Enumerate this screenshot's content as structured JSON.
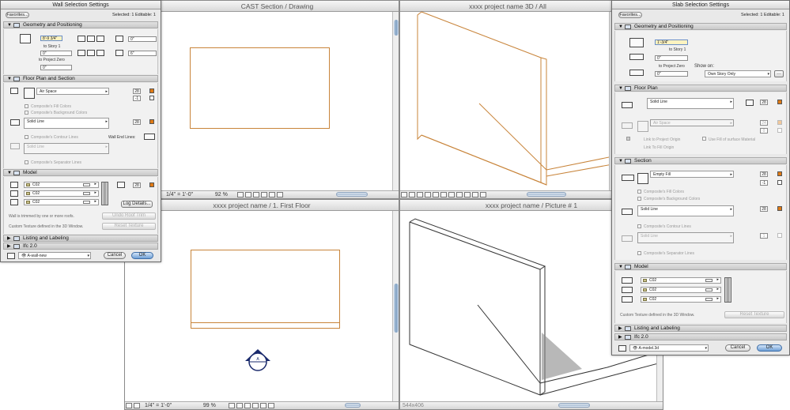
{
  "windows": {
    "section": {
      "title": "CAST Section / Drawing",
      "scale": "1/4\"  =  1'-0\"",
      "zoom": "92 %"
    },
    "view3d": {
      "title": "xxxx project name 3D / All"
    },
    "plan": {
      "title": "xxxx project name / 1. First Floor",
      "scale": "1/4\"  =  1'-0\"",
      "zoom": "99 %"
    },
    "picture": {
      "title": "xxxx project name / Picture # 1",
      "size": "544x406"
    }
  },
  "wall_dialog": {
    "title": "Wall Selection Settings",
    "favorites": "Favorites...",
    "selected": "Selected: 1 Editable: 1",
    "geometry": {
      "header": "Geometry and Positioning",
      "height": "8'-9 3/4\"",
      "to_story": "to Story 1",
      "base_offset": "0\"",
      "to_project_zero": "to Project Zero",
      "project_zero": "0\"",
      "thickness": "0\"",
      "thickness2": "6\""
    },
    "floor_plan": {
      "header": "Floor Plan and Section",
      "fill": "Air Space",
      "pen1": "28",
      "pen2": "-1",
      "composite_fill": "Composite's Fill Colors",
      "composite_bg": "Composite's Background Colors",
      "contour_line": "Solid Line",
      "pen3": "28",
      "composite_contour": "Composite's Contour Lines",
      "wall_end_lines": "Wall End Lines:",
      "sep_line": "Solid Line",
      "composite_sep": "Composite's Separator Lines"
    },
    "model": {
      "header": "Model",
      "materials": [
        "C02",
        "C02",
        "C02"
      ],
      "pen": "28",
      "log_details": "Log Details..."
    },
    "trim_note": "Wall is trimmed by one or more roofs.",
    "undo_roof_trim": "Undo Roof Trim",
    "texture_note": "Custom Texture defined in the 3D Window.",
    "reset_texture": "Reset Texture",
    "listing": "Listing and Labeling",
    "ifc": "Ifc 2.0",
    "layer": "A-wall-new",
    "cancel": "Cancel",
    "ok": "OK"
  },
  "slab_dialog": {
    "title": "Slab Selection Settings",
    "favorites": "Favorites...",
    "selected": "Selected: 1 Editable: 1",
    "geometry": {
      "header": "Geometry and Positioning",
      "thickness": "1'-3/4\"",
      "to_story": "to Story 1",
      "offset": "0\"",
      "to_project_zero": "to Project Zero",
      "project_zero": "0\"",
      "show_on_label": "Show on:",
      "show_on": "Own Story Only"
    },
    "floor_plan": {
      "header": "Floor Plan",
      "line": "Solid Line",
      "pen1": "28",
      "fill": "Air Space",
      "pen2": "24",
      "pen3": "0",
      "link_project_origin": "Link to Project Origin",
      "link_fill_origin": "Link To Fill Origin",
      "use_surface_fill": "Use Fill of surface Material"
    },
    "section": {
      "header": "Section",
      "fill": "Empty Fill",
      "pen1": "28",
      "pen2": "-1",
      "composite_fill": "Composite's Fill Colors",
      "composite_bg": "Composite's Background Colors",
      "contour_line": "Solid Line",
      "pen3": "28",
      "composite_contour": "Composite's Contour Lines",
      "sep_line": "Solid Line",
      "pen4": "1",
      "composite_sep": "Composite's Separator Lines"
    },
    "model": {
      "header": "Model",
      "materials": [
        "C02",
        "C02",
        "C02"
      ]
    },
    "texture_note": "Custom Texture defined in the 3D Window.",
    "reset_texture": "Reset Texture",
    "listing": "Listing and Labeling",
    "ifc": "Ifc 2.0",
    "layer": "A-model.3d",
    "cancel": "Cancel",
    "ok": "OK"
  },
  "colors": {
    "drawing_line": "#c8843a",
    "accent_orange": "#e07a14",
    "selection_blue": "#6b8fc7"
  }
}
